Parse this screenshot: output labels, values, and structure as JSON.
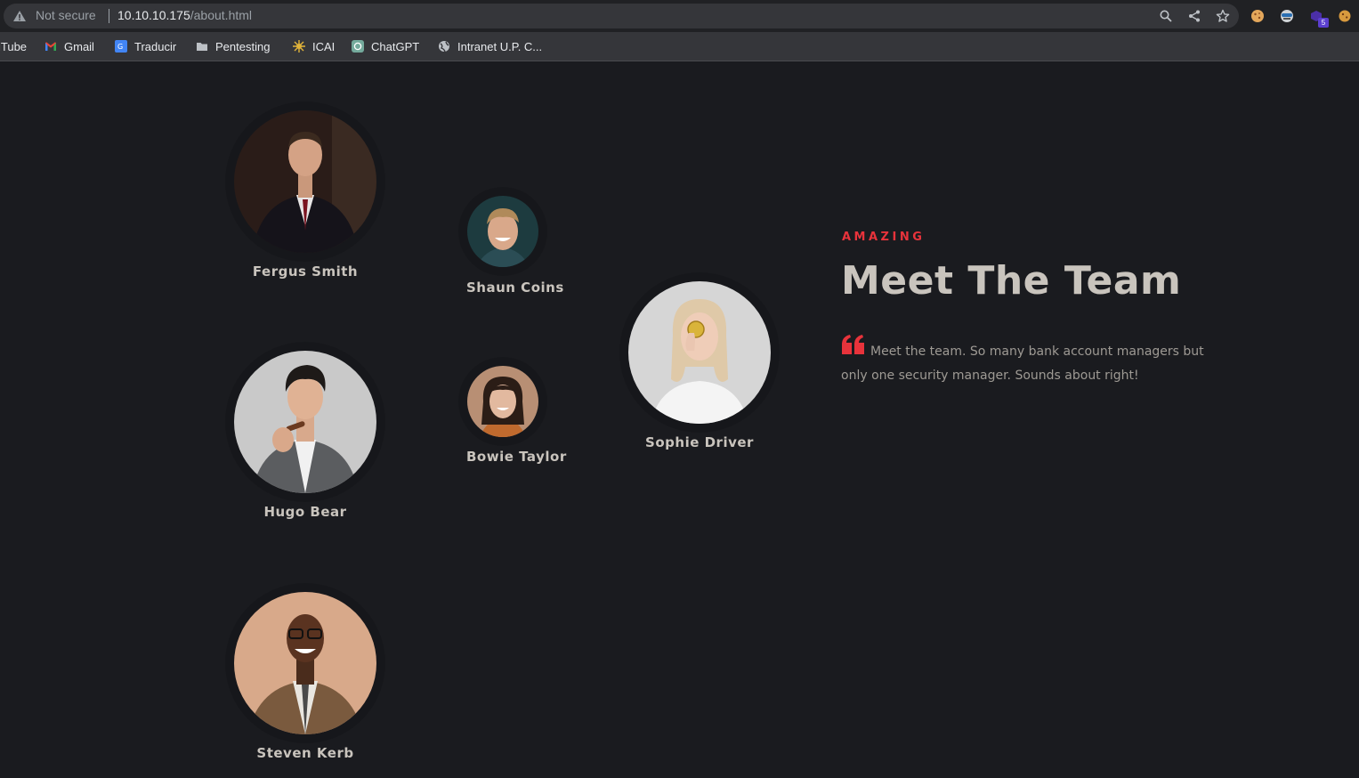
{
  "browser": {
    "security_label": "Not secure",
    "url_host": "10.10.10.175",
    "url_path": "/about.html",
    "extension_badge": "5",
    "bookmarks": [
      {
        "label": "iTube",
        "icon": "youtube-icon"
      },
      {
        "label": "Gmail",
        "icon": "gmail-icon"
      },
      {
        "label": "Traducir",
        "icon": "translate-icon"
      },
      {
        "label": "Pentesting",
        "icon": "folder-icon"
      },
      {
        "label": "ICAI",
        "icon": "icai-icon"
      },
      {
        "label": "ChatGPT",
        "icon": "chatgpt-icon"
      },
      {
        "label": "Intranet U.P. C...",
        "icon": "globe-icon"
      }
    ]
  },
  "team": {
    "eyebrow": "AMAZING",
    "heading": "Meet The Team",
    "quote": "Meet the team. So many bank account managers but only one security manager. Sounds about right!",
    "members": [
      {
        "name": "Fergus Smith"
      },
      {
        "name": "Shaun Coins"
      },
      {
        "name": "Sophie Driver"
      },
      {
        "name": "Hugo Bear"
      },
      {
        "name": "Bowie Taylor"
      },
      {
        "name": "Steven Kerb"
      }
    ]
  },
  "colors": {
    "accent": "#e8333b",
    "background": "#1a1b1f",
    "name_text": "#c9c4bd"
  }
}
